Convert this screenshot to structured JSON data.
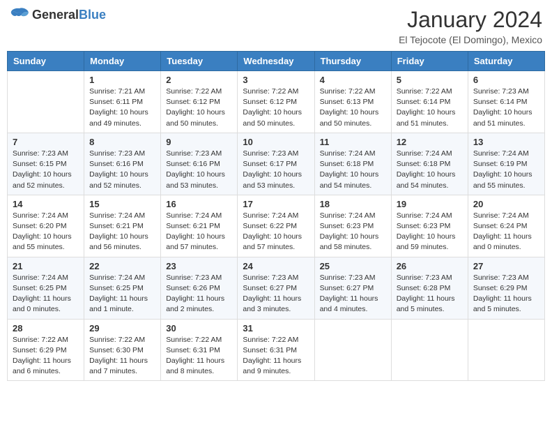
{
  "header": {
    "logo_general": "General",
    "logo_blue": "Blue",
    "month_title": "January 2024",
    "location": "El Tejocote (El Domingo), Mexico"
  },
  "days_of_week": [
    "Sunday",
    "Monday",
    "Tuesday",
    "Wednesday",
    "Thursday",
    "Friday",
    "Saturday"
  ],
  "weeks": [
    [
      {
        "day": "",
        "info": ""
      },
      {
        "day": "1",
        "info": "Sunrise: 7:21 AM\nSunset: 6:11 PM\nDaylight: 10 hours\nand 49 minutes."
      },
      {
        "day": "2",
        "info": "Sunrise: 7:22 AM\nSunset: 6:12 PM\nDaylight: 10 hours\nand 50 minutes."
      },
      {
        "day": "3",
        "info": "Sunrise: 7:22 AM\nSunset: 6:12 PM\nDaylight: 10 hours\nand 50 minutes."
      },
      {
        "day": "4",
        "info": "Sunrise: 7:22 AM\nSunset: 6:13 PM\nDaylight: 10 hours\nand 50 minutes."
      },
      {
        "day": "5",
        "info": "Sunrise: 7:22 AM\nSunset: 6:14 PM\nDaylight: 10 hours\nand 51 minutes."
      },
      {
        "day": "6",
        "info": "Sunrise: 7:23 AM\nSunset: 6:14 PM\nDaylight: 10 hours\nand 51 minutes."
      }
    ],
    [
      {
        "day": "7",
        "info": "Sunrise: 7:23 AM\nSunset: 6:15 PM\nDaylight: 10 hours\nand 52 minutes."
      },
      {
        "day": "8",
        "info": "Sunrise: 7:23 AM\nSunset: 6:16 PM\nDaylight: 10 hours\nand 52 minutes."
      },
      {
        "day": "9",
        "info": "Sunrise: 7:23 AM\nSunset: 6:16 PM\nDaylight: 10 hours\nand 53 minutes."
      },
      {
        "day": "10",
        "info": "Sunrise: 7:23 AM\nSunset: 6:17 PM\nDaylight: 10 hours\nand 53 minutes."
      },
      {
        "day": "11",
        "info": "Sunrise: 7:24 AM\nSunset: 6:18 PM\nDaylight: 10 hours\nand 54 minutes."
      },
      {
        "day": "12",
        "info": "Sunrise: 7:24 AM\nSunset: 6:18 PM\nDaylight: 10 hours\nand 54 minutes."
      },
      {
        "day": "13",
        "info": "Sunrise: 7:24 AM\nSunset: 6:19 PM\nDaylight: 10 hours\nand 55 minutes."
      }
    ],
    [
      {
        "day": "14",
        "info": "Sunrise: 7:24 AM\nSunset: 6:20 PM\nDaylight: 10 hours\nand 55 minutes."
      },
      {
        "day": "15",
        "info": "Sunrise: 7:24 AM\nSunset: 6:21 PM\nDaylight: 10 hours\nand 56 minutes."
      },
      {
        "day": "16",
        "info": "Sunrise: 7:24 AM\nSunset: 6:21 PM\nDaylight: 10 hours\nand 57 minutes."
      },
      {
        "day": "17",
        "info": "Sunrise: 7:24 AM\nSunset: 6:22 PM\nDaylight: 10 hours\nand 57 minutes."
      },
      {
        "day": "18",
        "info": "Sunrise: 7:24 AM\nSunset: 6:23 PM\nDaylight: 10 hours\nand 58 minutes."
      },
      {
        "day": "19",
        "info": "Sunrise: 7:24 AM\nSunset: 6:23 PM\nDaylight: 10 hours\nand 59 minutes."
      },
      {
        "day": "20",
        "info": "Sunrise: 7:24 AM\nSunset: 6:24 PM\nDaylight: 11 hours\nand 0 minutes."
      }
    ],
    [
      {
        "day": "21",
        "info": "Sunrise: 7:24 AM\nSunset: 6:25 PM\nDaylight: 11 hours\nand 0 minutes."
      },
      {
        "day": "22",
        "info": "Sunrise: 7:24 AM\nSunset: 6:25 PM\nDaylight: 11 hours\nand 1 minute."
      },
      {
        "day": "23",
        "info": "Sunrise: 7:23 AM\nSunset: 6:26 PM\nDaylight: 11 hours\nand 2 minutes."
      },
      {
        "day": "24",
        "info": "Sunrise: 7:23 AM\nSunset: 6:27 PM\nDaylight: 11 hours\nand 3 minutes."
      },
      {
        "day": "25",
        "info": "Sunrise: 7:23 AM\nSunset: 6:27 PM\nDaylight: 11 hours\nand 4 minutes."
      },
      {
        "day": "26",
        "info": "Sunrise: 7:23 AM\nSunset: 6:28 PM\nDaylight: 11 hours\nand 5 minutes."
      },
      {
        "day": "27",
        "info": "Sunrise: 7:23 AM\nSunset: 6:29 PM\nDaylight: 11 hours\nand 5 minutes."
      }
    ],
    [
      {
        "day": "28",
        "info": "Sunrise: 7:22 AM\nSunset: 6:29 PM\nDaylight: 11 hours\nand 6 minutes."
      },
      {
        "day": "29",
        "info": "Sunrise: 7:22 AM\nSunset: 6:30 PM\nDaylight: 11 hours\nand 7 minutes."
      },
      {
        "day": "30",
        "info": "Sunrise: 7:22 AM\nSunset: 6:31 PM\nDaylight: 11 hours\nand 8 minutes."
      },
      {
        "day": "31",
        "info": "Sunrise: 7:22 AM\nSunset: 6:31 PM\nDaylight: 11 hours\nand 9 minutes."
      },
      {
        "day": "",
        "info": ""
      },
      {
        "day": "",
        "info": ""
      },
      {
        "day": "",
        "info": ""
      }
    ]
  ]
}
